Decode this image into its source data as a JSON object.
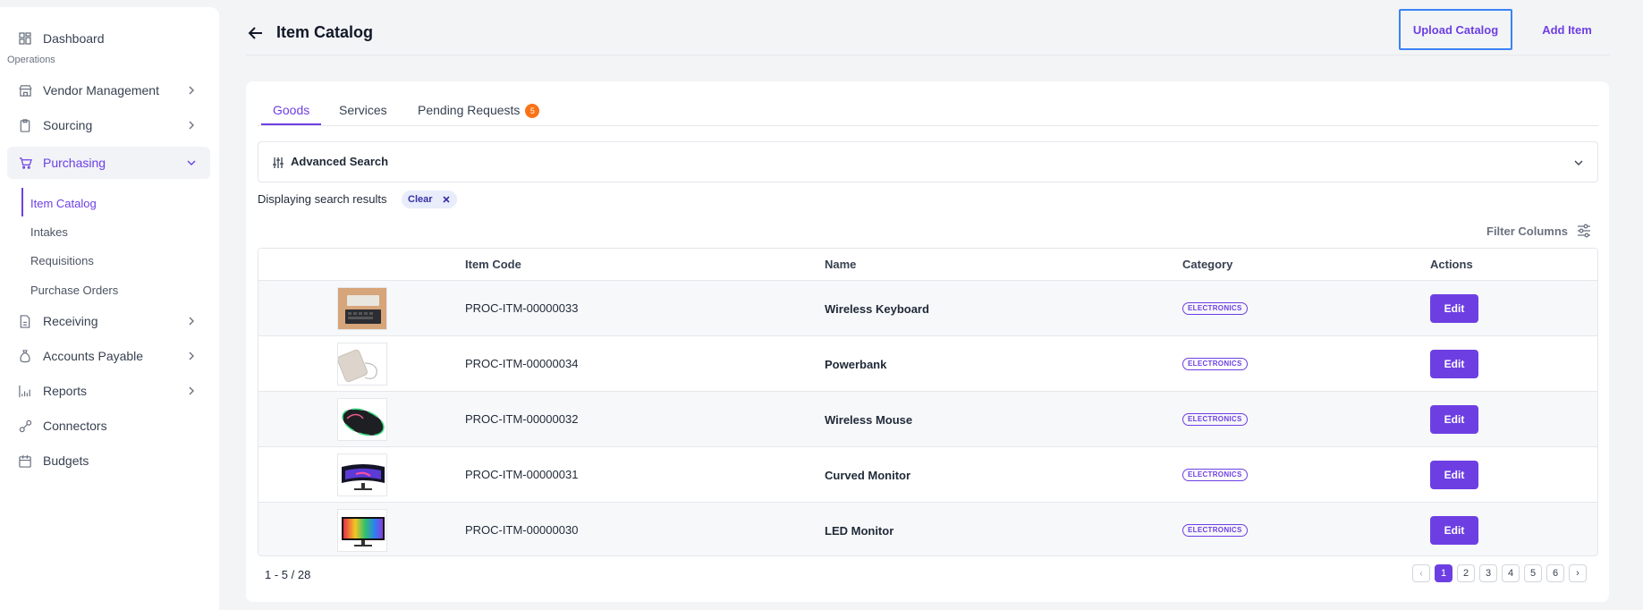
{
  "sidebar": {
    "items": [
      {
        "label": "Dashboard",
        "icon": "grid-icon"
      },
      {
        "label": "Vendor Management",
        "icon": "store-icon"
      },
      {
        "label": "Sourcing",
        "icon": "clipboard-icon"
      },
      {
        "label": "Purchasing",
        "icon": "cart-icon"
      },
      {
        "label": "Receiving",
        "icon": "document-icon"
      },
      {
        "label": "Accounts Payable",
        "icon": "money-bag-icon"
      },
      {
        "label": "Reports",
        "icon": "chart-icon"
      },
      {
        "label": "Connectors",
        "icon": "link-icon"
      },
      {
        "label": "Budgets",
        "icon": "calendar-icon"
      }
    ],
    "section_label": "Operations",
    "purchasing_sub": [
      "Item Catalog",
      "Intakes",
      "Requisitions",
      "Purchase Orders"
    ]
  },
  "header": {
    "title": "Item Catalog",
    "upload_label": "Upload Catalog",
    "add_label": "Add Item"
  },
  "tabs": [
    {
      "label": "Goods"
    },
    {
      "label": "Services"
    },
    {
      "label": "Pending Requests",
      "badge": "5"
    }
  ],
  "search": {
    "advanced_label": "Advanced Search",
    "results_text": "Displaying search results",
    "clear_label": "Clear",
    "filter_columns_label": "Filter Columns"
  },
  "table": {
    "columns": [
      "Item Code",
      "Name",
      "Category",
      "Actions"
    ],
    "rows": [
      {
        "code": "PROC-ITM-00000033",
        "name": "Wireless Keyboard",
        "category": "ELECTRONICS",
        "action": "Edit"
      },
      {
        "code": "PROC-ITM-00000034",
        "name": "Powerbank",
        "category": "ELECTRONICS",
        "action": "Edit"
      },
      {
        "code": "PROC-ITM-00000032",
        "name": "Wireless Mouse",
        "category": "ELECTRONICS",
        "action": "Edit"
      },
      {
        "code": "PROC-ITM-00000031",
        "name": "Curved Monitor",
        "category": "ELECTRONICS",
        "action": "Edit"
      },
      {
        "code": "PROC-ITM-00000030",
        "name": "LED Monitor",
        "category": "ELECTRONICS",
        "action": "Edit"
      }
    ]
  },
  "pagination": {
    "summary": "1 - 5 / 28",
    "pages": [
      "1",
      "2",
      "3",
      "4",
      "5",
      "6"
    ],
    "prev": "‹",
    "next": "›",
    "current": "1"
  },
  "colors": {
    "accent": "#6d3fe3",
    "badge": "#f97316",
    "focus_border": "#3b82f6"
  }
}
